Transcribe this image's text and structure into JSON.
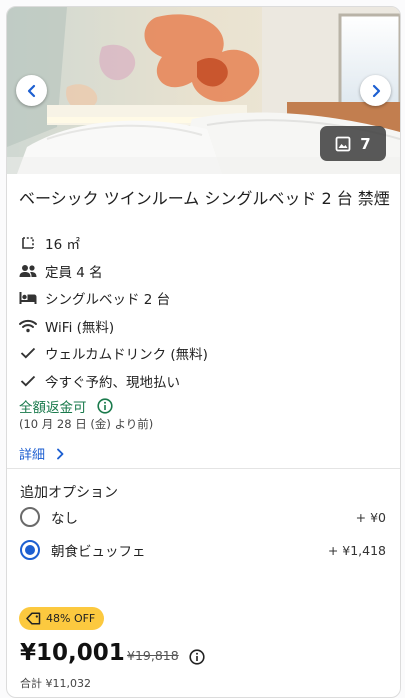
{
  "room": {
    "title": "ベーシック ツインルーム シングルベッド 2 台 禁煙",
    "photo_count": "7"
  },
  "amenities": [
    {
      "icon": "room-size-icon",
      "label": "16 ㎡"
    },
    {
      "icon": "people-icon",
      "label": "定員 4 名"
    },
    {
      "icon": "bed-icon",
      "label": "シングルベッド 2 台"
    },
    {
      "icon": "wifi-icon",
      "label": "WiFi (無料)"
    },
    {
      "icon": "check-icon",
      "label": "ウェルカムドリンク (無料)"
    },
    {
      "icon": "check-icon",
      "label": "今すぐ予約、現地払い"
    }
  ],
  "refund": {
    "label": "全額返金可",
    "date": "(10 月 28 日 (金) より前)"
  },
  "details_link": "詳細",
  "options": {
    "heading": "追加オプション",
    "items": [
      {
        "label": "なし",
        "price": "+ ¥0",
        "selected": false
      },
      {
        "label": "朝食ビュッフェ",
        "price": "+ ¥1,418",
        "selected": true
      }
    ]
  },
  "pricing": {
    "discount_badge": "48% OFF",
    "current": "¥10,001",
    "original": "¥19,818",
    "total": "合計 ¥11,032"
  },
  "colors": {
    "link_blue": "#1d5fd1",
    "refund_green": "#1a7a4c",
    "badge_yellow": "#fcc93f"
  }
}
